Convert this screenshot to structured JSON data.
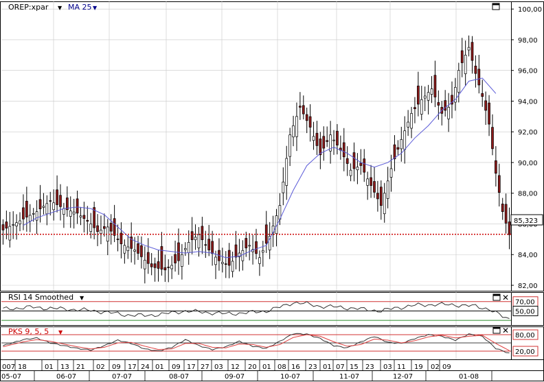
{
  "header": {
    "symbol_label": "OREP:xpar",
    "indicator_label": "MA 25"
  },
  "rsi_panel": {
    "label": "RSI 14 Smoothed",
    "levels": [
      "70,00",
      "50,00"
    ]
  },
  "pks_panel": {
    "label": "PKS 9, 5, 5",
    "levels": [
      "80,00",
      "20,00"
    ]
  },
  "colors": {
    "ma_line": "#5a5ad8",
    "price_marker": "#cc0000",
    "bear_candle": "#8b1a1a",
    "bull_candle": "#ffffff",
    "rsi_line": "#333333",
    "pks_fast": "#333333",
    "pks_slow": "#e04040",
    "grid": "#c8c8c8",
    "level_red": "#d03030",
    "level_green": "#2a8a2a",
    "header_text": "#00008b"
  },
  "chart_data": [
    {
      "type": "candlestick",
      "title": "OREP:xpar",
      "ylim": [
        82,
        100.5
      ],
      "y_ticks": [
        "82,00",
        "84,00",
        "86,00",
        "88,00",
        "90,00",
        "92,00",
        "94,00",
        "96,00",
        "98,00",
        "100,00"
      ],
      "last_price": "85,323",
      "x_day_labels": [
        "007",
        "18",
        "01",
        "13",
        "21",
        "02",
        "09",
        "17",
        "24",
        "01",
        "09",
        "17",
        "27",
        "03",
        "12",
        "20",
        "01",
        "08",
        "16",
        "23",
        "01",
        "07",
        "15",
        "23",
        "03",
        "11",
        "19",
        "02",
        "09"
      ],
      "x_month_labels": [
        "05-07",
        "06-07",
        "07-07",
        "08-07",
        "09-07",
        "10-07",
        "11-07",
        "12-07",
        "01-08"
      ],
      "close_path": [
        [
          0,
          85.6
        ],
        [
          5,
          86.2
        ],
        [
          10,
          86.8
        ],
        [
          14,
          87.5
        ],
        [
          18,
          87.0
        ],
        [
          22,
          86.7
        ],
        [
          26,
          86.0
        ],
        [
          28,
          85.5
        ],
        [
          31,
          85.8
        ],
        [
          35,
          84.7
        ],
        [
          39,
          84.3
        ],
        [
          44,
          83.2
        ],
        [
          48,
          83.0
        ],
        [
          52,
          83.6
        ],
        [
          55,
          84.8
        ],
        [
          58,
          85.3
        ],
        [
          61,
          84.3
        ],
        [
          64,
          83.6
        ],
        [
          67,
          83.3
        ],
        [
          70,
          84.1
        ],
        [
          73,
          84.6
        ],
        [
          76,
          83.8
        ],
        [
          79,
          85.2
        ],
        [
          82,
          87.2
        ],
        [
          85,
          91.8
        ],
        [
          88,
          93.6
        ],
        [
          91,
          92.3
        ],
        [
          94,
          90.5
        ],
        [
          97,
          91.8
        ],
        [
          100,
          90.8
        ],
        [
          103,
          89.5
        ],
        [
          106,
          89.8
        ],
        [
          109,
          88.5
        ],
        [
          112,
          87.2
        ],
        [
          115,
          89.6
        ],
        [
          118,
          91.5
        ],
        [
          121,
          93.2
        ],
        [
          124,
          94.1
        ],
        [
          127,
          94.8
        ],
        [
          130,
          93.2
        ],
        [
          133,
          93.8
        ],
        [
          135,
          96.0
        ],
        [
          138,
          97.5
        ],
        [
          140,
          95.8
        ],
        [
          142,
          94.3
        ],
        [
          144,
          92.5
        ],
        [
          146,
          89.3
        ],
        [
          148,
          86.8
        ],
        [
          150,
          85.3
        ]
      ],
      "bear_bars": [
        7,
        16,
        19,
        27,
        33,
        41,
        47,
        52,
        59,
        64,
        69,
        75,
        78,
        95,
        104,
        110,
        116,
        123,
        131,
        136,
        139,
        144,
        146,
        149
      ],
      "series": [
        {
          "name": "MA 25",
          "values": [
            [
              6,
              85.9
            ],
            [
              10,
              86.4
            ],
            [
              14,
              86.7
            ],
            [
              18,
              87.0
            ],
            [
              22,
              87.1
            ],
            [
              26,
              87.0
            ],
            [
              30,
              86.6
            ],
            [
              34,
              85.8
            ],
            [
              38,
              85.0
            ],
            [
              42,
              84.6
            ],
            [
              46,
              84.3
            ],
            [
              50,
              84.2
            ],
            [
              54,
              84.1
            ],
            [
              58,
              84.2
            ],
            [
              62,
              84.1
            ],
            [
              66,
              83.8
            ],
            [
              70,
              83.9
            ],
            [
              74,
              84.3
            ],
            [
              78,
              84.6
            ],
            [
              82,
              86.3
            ],
            [
              86,
              88.2
            ],
            [
              90,
              89.8
            ],
            [
              94,
              90.6
            ],
            [
              98,
              91.0
            ],
            [
              102,
              90.6
            ],
            [
              106,
              90.0
            ],
            [
              110,
              89.7
            ],
            [
              114,
              90.0
            ],
            [
              118,
              90.6
            ],
            [
              122,
              91.6
            ],
            [
              126,
              92.4
            ],
            [
              130,
              93.4
            ],
            [
              134,
              94.1
            ],
            [
              138,
              95.3
            ],
            [
              142,
              95.5
            ],
            [
              146,
              94.5
            ]
          ]
        }
      ]
    },
    {
      "type": "line",
      "title": "RSI 14 Smoothed",
      "ylim": [
        20,
        90
      ],
      "y_ticks": [
        "70,00",
        "50,00"
      ],
      "series": [
        {
          "name": "RSI 14 Smoothed",
          "values": [
            [
              0,
              54
            ],
            [
              8,
              58
            ],
            [
              16,
              55
            ],
            [
              24,
              52
            ],
            [
              30,
              48
            ],
            [
              36,
              42
            ],
            [
              42,
              40
            ],
            [
              48,
              44
            ],
            [
              54,
              50
            ],
            [
              60,
              47
            ],
            [
              66,
              44
            ],
            [
              72,
              46
            ],
            [
              78,
              50
            ],
            [
              82,
              58
            ],
            [
              86,
              68
            ],
            [
              90,
              65
            ],
            [
              94,
              60
            ],
            [
              100,
              58
            ],
            [
              106,
              54
            ],
            [
              112,
              50
            ],
            [
              116,
              56
            ],
            [
              122,
              62
            ],
            [
              128,
              64
            ],
            [
              134,
              63
            ],
            [
              140,
              60
            ],
            [
              144,
              54
            ],
            [
              148,
              38
            ],
            [
              150,
              33
            ]
          ]
        }
      ]
    },
    {
      "type": "line",
      "title": "PKS 9, 5, 5",
      "ylim": [
        0,
        100
      ],
      "y_ticks": [
        "80,00",
        "20,00"
      ],
      "series": [
        {
          "name": "PKS 9, 5, 5",
          "values": [
            [
              0,
              40
            ],
            [
              6,
              62
            ],
            [
              10,
              68
            ],
            [
              14,
              50
            ],
            [
              18,
              40
            ],
            [
              22,
              30
            ],
            [
              26,
              24
            ],
            [
              30,
              40
            ],
            [
              34,
              60
            ],
            [
              38,
              48
            ],
            [
              42,
              28
            ],
            [
              46,
              20
            ],
            [
              50,
              34
            ],
            [
              54,
              62
            ],
            [
              58,
              40
            ],
            [
              62,
              26
            ],
            [
              66,
              36
            ],
            [
              70,
              56
            ],
            [
              74,
              38
            ],
            [
              78,
              30
            ],
            [
              82,
              56
            ],
            [
              86,
              84
            ],
            [
              90,
              82
            ],
            [
              94,
              66
            ],
            [
              98,
              40
            ],
            [
              102,
              32
            ],
            [
              106,
              54
            ],
            [
              110,
              74
            ],
            [
              114,
              52
            ],
            [
              118,
              48
            ],
            [
              122,
              66
            ],
            [
              126,
              80
            ],
            [
              130,
              74
            ],
            [
              134,
              60
            ],
            [
              138,
              82
            ],
            [
              142,
              74
            ],
            [
              146,
              30
            ],
            [
              150,
              12
            ]
          ]
        },
        {
          "values": [
            [
              0,
              36
            ],
            [
              6,
              54
            ],
            [
              10,
              62
            ],
            [
              14,
              56
            ],
            [
              18,
              46
            ],
            [
              22,
              36
            ],
            [
              26,
              28
            ],
            [
              30,
              34
            ],
            [
              34,
              50
            ],
            [
              38,
              52
            ],
            [
              42,
              38
            ],
            [
              46,
              26
            ],
            [
              50,
              28
            ],
            [
              54,
              48
            ],
            [
              58,
              48
            ],
            [
              62,
              34
            ],
            [
              66,
              32
            ],
            [
              70,
              46
            ],
            [
              74,
              44
            ],
            [
              78,
              34
            ],
            [
              82,
              44
            ],
            [
              86,
              70
            ],
            [
              90,
              80
            ],
            [
              94,
              74
            ],
            [
              98,
              54
            ],
            [
              102,
              38
            ],
            [
              106,
              44
            ],
            [
              110,
              64
            ],
            [
              114,
              60
            ],
            [
              118,
              50
            ],
            [
              122,
              58
            ],
            [
              126,
              72
            ],
            [
              130,
              78
            ],
            [
              134,
              68
            ],
            [
              138,
              74
            ],
            [
              142,
              78
            ],
            [
              146,
              48
            ],
            [
              150,
              22
            ]
          ]
        }
      ]
    }
  ]
}
